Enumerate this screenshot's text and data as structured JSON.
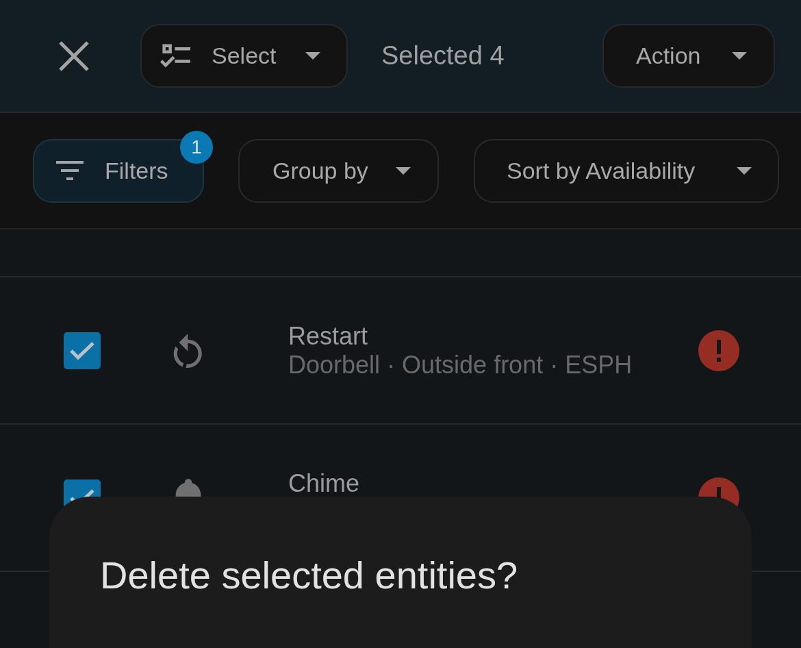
{
  "toolbar": {
    "select_button": {
      "label": "Select"
    },
    "selection_count": "Selected 4",
    "action_button": {
      "label": "Action"
    }
  },
  "filter_bar": {
    "filters_button": {
      "label": "Filters",
      "badge": "1",
      "active": true
    },
    "group_by_button": {
      "label": "Group by"
    },
    "sort_button": {
      "label": "Sort by Availability"
    }
  },
  "rows": [
    {
      "kind": "restart",
      "title": "Restart",
      "subtitle": "Doorbell · Outside front · ESPH",
      "checked": true,
      "error": true
    },
    {
      "kind": "bell",
      "title": "Chime",
      "checked": true,
      "error": true
    }
  ],
  "dialog": {
    "title": "Delete selected entities?"
  }
}
